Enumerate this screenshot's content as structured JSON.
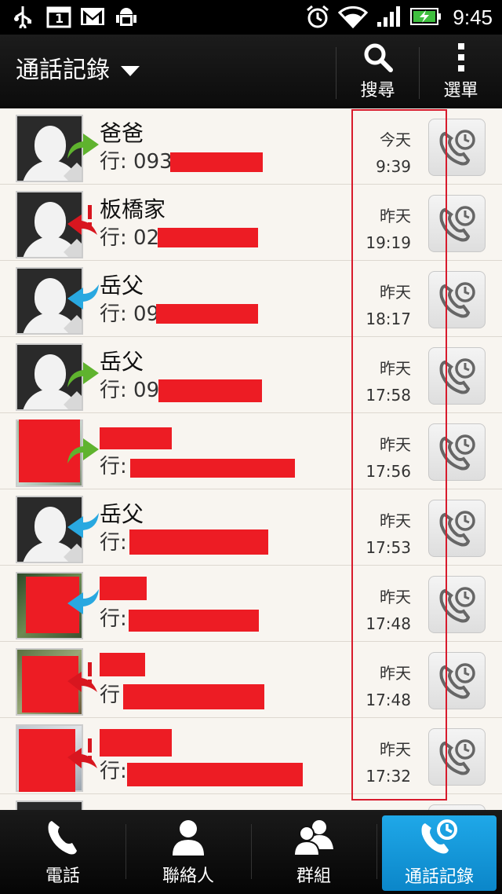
{
  "status_bar": {
    "time": "9:45",
    "calendar_day": "1",
    "left_icons": [
      "usb-icon",
      "calendar-icon",
      "gmail-icon",
      "android-debug-icon"
    ],
    "right_icons": [
      "alarm-icon",
      "wifi-icon",
      "signal-icon",
      "battery-charging-icon"
    ]
  },
  "action_bar": {
    "title": "通話記錄",
    "search_label": "搜尋",
    "menu_label": "選單"
  },
  "call_log": [
    {
      "name": "爸爸",
      "number": "行: 093",
      "day": "今天",
      "time": "9:39",
      "type": "outgoing",
      "avatar": "default"
    },
    {
      "name": "板橋家",
      "number": "行: 02",
      "day": "昨天",
      "time": "19:19",
      "type": "missed",
      "avatar": "default"
    },
    {
      "name": "岳父",
      "number": "行: 09",
      "day": "昨天",
      "time": "18:17",
      "type": "incoming",
      "avatar": "default"
    },
    {
      "name": "岳父",
      "number": "行: 09",
      "day": "昨天",
      "time": "17:58",
      "type": "outgoing",
      "avatar": "default"
    },
    {
      "name": "",
      "number": "行:",
      "day": "昨天",
      "time": "17:56",
      "type": "outgoing",
      "avatar": "photo"
    },
    {
      "name": "岳父",
      "number": "行:",
      "day": "昨天",
      "time": "17:53",
      "type": "incoming",
      "avatar": "default"
    },
    {
      "name": "",
      "number": "行:",
      "day": "昨天",
      "time": "17:48",
      "type": "incoming",
      "avatar": "photo"
    },
    {
      "name": "",
      "number": "行",
      "day": "昨天",
      "time": "17:48",
      "type": "missed",
      "avatar": "photo"
    },
    {
      "name": "",
      "number": "行:",
      "day": "昨天",
      "time": "17:32",
      "type": "missed",
      "avatar": "photo"
    }
  ],
  "bottom_nav": {
    "tabs": [
      {
        "label": "電話",
        "icon": "phone-icon"
      },
      {
        "label": "聯絡人",
        "icon": "person-icon"
      },
      {
        "label": "群組",
        "icon": "group-icon"
      },
      {
        "label": "通話記錄",
        "icon": "call-history-icon"
      }
    ],
    "active_index": 3
  },
  "colors": {
    "outgoing_arrow": "#5fb32e",
    "incoming_arrow": "#29a8e0",
    "missed_arrow": "#d8161f",
    "active_tab": "#1296da",
    "highlight_box": "#d81b2c",
    "redaction": "#ed1c24"
  }
}
